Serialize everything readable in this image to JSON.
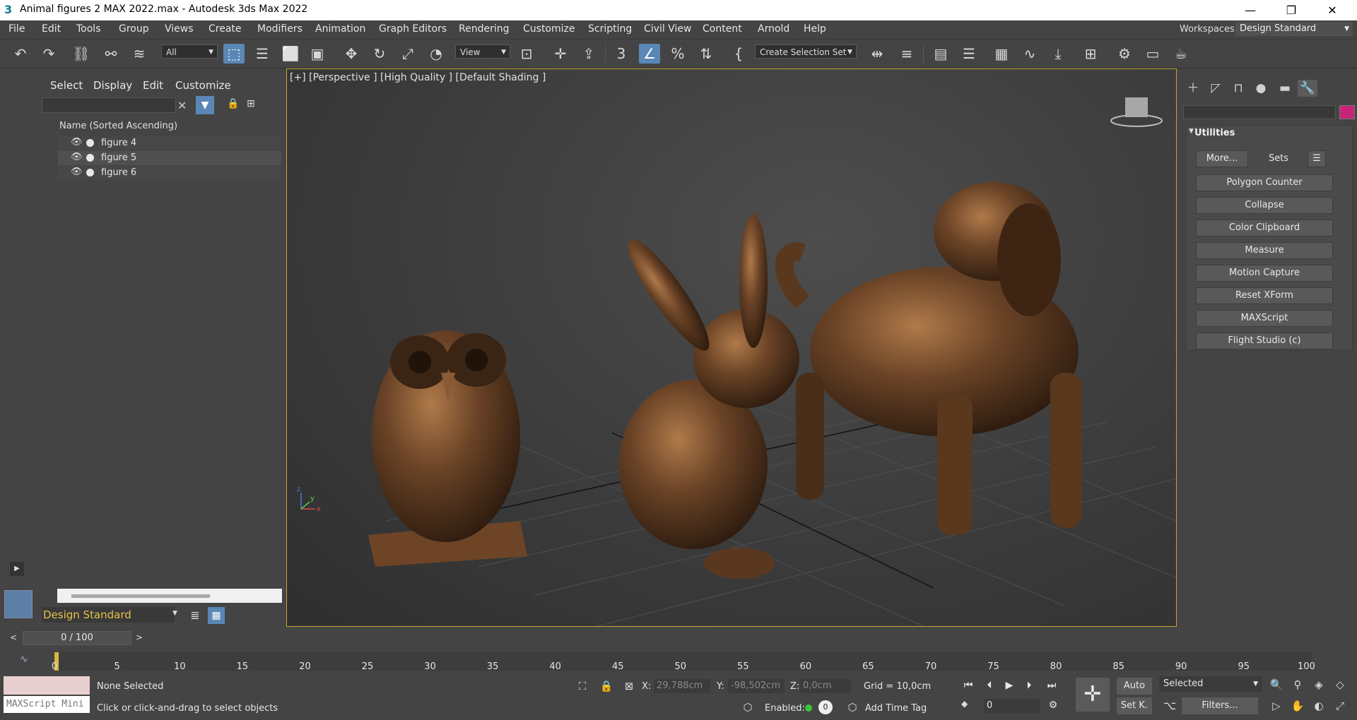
{
  "window": {
    "title": "Animal figures 2 MAX 2022.max - Autodesk 3ds Max 2022",
    "minimize": "—",
    "restore": "❐",
    "close": "✕"
  },
  "menu": [
    "File",
    "Edit",
    "Tools",
    "Group",
    "Views",
    "Create",
    "Modifiers",
    "Animation",
    "Graph Editors",
    "Rendering",
    "Customize",
    "Scripting",
    "Civil View",
    "Content",
    "Arnold",
    "Help"
  ],
  "workspaces": {
    "label": "Workspaces:",
    "value": "Design Standard"
  },
  "toolbar": {
    "filter_select": "All",
    "ref_coord_select": "View",
    "selection_set": "Create Selection Set"
  },
  "explorer": {
    "tabs": [
      "Select",
      "Display",
      "Edit",
      "Customize"
    ],
    "column_header": "Name (Sorted Ascending)",
    "rows": [
      "figure 4",
      "figure 5",
      "figure 6"
    ],
    "layer_field": "Design Standard"
  },
  "viewport": {
    "label": "[+] [Perspective ] [High Quality ] [Default Shading ]",
    "axis_x": "x",
    "axis_y": "y",
    "axis_z": "z"
  },
  "command_panel": {
    "rollout_title": "Utilities",
    "more_button": "More...",
    "sets_button": "Sets",
    "utilities": [
      "Polygon Counter",
      "Collapse",
      "Color Clipboard",
      "Measure",
      "Motion Capture",
      "Reset XForm",
      "MAXScript",
      "Flight Studio (c)"
    ]
  },
  "timeline": {
    "slider_label": "0 / 100",
    "prev": "<",
    "next": ">",
    "ticks": [
      "0",
      "5",
      "10",
      "15",
      "20",
      "25",
      "30",
      "35",
      "40",
      "45",
      "50",
      "55",
      "60",
      "65",
      "70",
      "75",
      "80",
      "85",
      "90",
      "95",
      "100"
    ]
  },
  "status": {
    "maxscript_label": "MAXScript Mini",
    "selection": "None Selected",
    "prompt": "Click or click-and-drag to select objects",
    "x_label": "X:",
    "x_value": "29,788cm",
    "y_label": "Y:",
    "y_value": "-98,502cm",
    "z_label": "Z:",
    "z_value": "0,0cm",
    "grid": "Grid = 10,0cm",
    "enabled": "Enabled:",
    "enabled_value": "0",
    "add_time_tag": "Add Time Tag",
    "auto": "Auto",
    "set_key": "Set K.",
    "key_filter": "Selected",
    "filters": "Filters...",
    "frame_value": "0"
  },
  "colors": {
    "viewport_border": "#c8a63a",
    "active_button": "#5a87b5",
    "object_color": "#c8257a",
    "layer_text": "#e6c24c"
  }
}
